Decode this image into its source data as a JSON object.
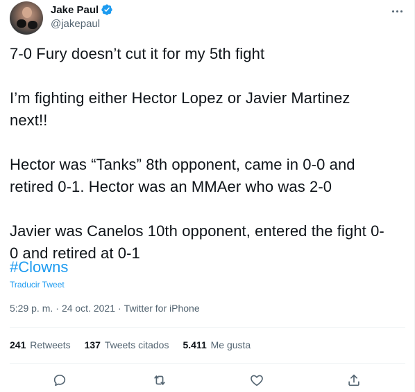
{
  "author": {
    "display_name": "Jake Paul",
    "handle": "@jakepaul",
    "verified": true
  },
  "tweet": {
    "text": "7-0 Fury doesn’t cut it for my 5th fight\n\nI’m fighting either Hector Lopez or Javier Martinez\nnext!!\n\nHector was “Tanks” 8th opponent, came in 0-0 and\nretired 0-1. Hector was an MMAer who was 2-0\n\nJavier was Canelos 10th opponent, entered the fight 0-\n0 and retired at 0-1",
    "hashtag": "#Clowns",
    "translate_label": "Traducir Tweet",
    "time": "5:29 p. m.",
    "separator": "·",
    "date": "24 oct. 2021",
    "source": "Twitter for iPhone"
  },
  "stats": {
    "retweets_count": "241",
    "retweets_label": "Retweets",
    "quotes_count": "137",
    "quotes_label": "Tweets citados",
    "likes_count": "5.411",
    "likes_label": "Me gusta"
  },
  "icons": {
    "more": "more-horizontal-icon",
    "verified": "verified-badge-icon",
    "reply": "reply-icon",
    "retweet": "retweet-icon",
    "like": "heart-icon",
    "share": "share-icon"
  },
  "colors": {
    "accent": "#1d9bf0",
    "text": "#0f1419",
    "muted": "#536471",
    "divider": "#eff3f4"
  }
}
